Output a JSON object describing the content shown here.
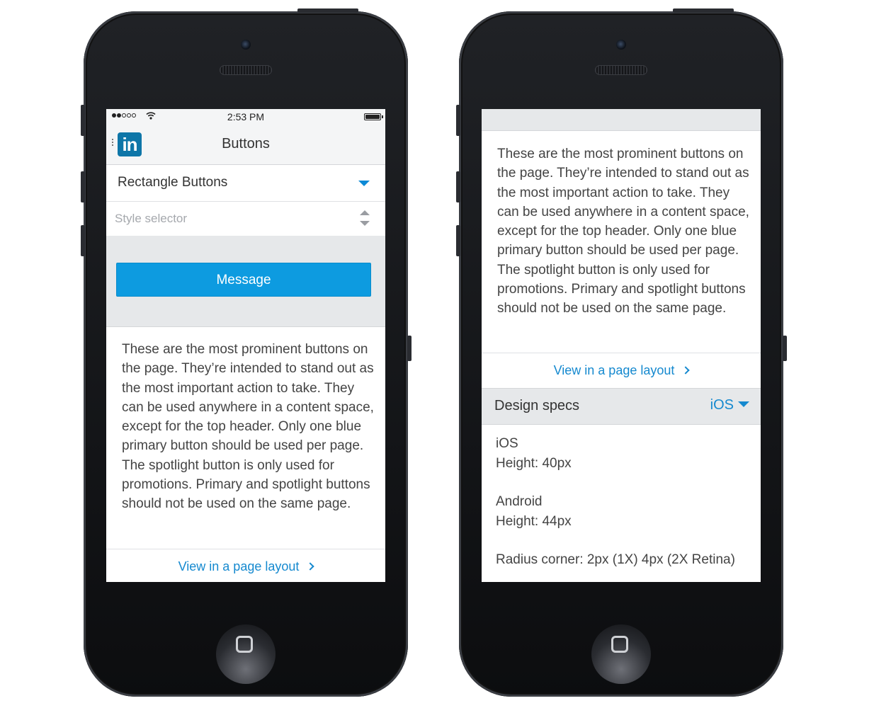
{
  "left_screen": {
    "status_bar": {
      "time": "2:53 PM"
    },
    "nav": {
      "logo": "in",
      "title": "Buttons"
    },
    "type_dropdown": {
      "value": "Rectangle Buttons"
    },
    "style_selector": {
      "placeholder": "Style selector"
    },
    "preview": {
      "button_label": "Message"
    },
    "description": "These are the most prominent buttons on the page. They’re intended to stand out as the most important action to take. They can be used anywhere in a content space, except for the top header. Only one blue primary button should be used per page. The spotlight button is only used for promotions. Primary and spotlight buttons should not be used on the same page.",
    "view_link": "View in a page layout"
  },
  "right_screen": {
    "description": "These are the most prominent buttons on the page. They’re intended to stand out as the most important action to take. They can be used anywhere in a content space, except for the top header. Only one blue primary button should be used per page. The spotlight button is only used for promotions. Primary and spotlight buttons should not be used on the same page.",
    "view_link": "View in a page layout",
    "specs": {
      "title": "Design specs",
      "platform": "iOS",
      "lines": [
        "iOS",
        "Height: 40px",
        "Android",
        "Height: 44px",
        "Radius corner: 2px (1X) 4px (2X Retina)"
      ]
    }
  },
  "colors": {
    "accent": "#0d9be0",
    "link": "#1589cf",
    "brand": "#0e76a8"
  },
  "icons": [
    "linkedin-logo",
    "signal-icon",
    "wifi-icon",
    "battery-icon",
    "chevron-down-icon",
    "stepper-icon",
    "chevron-right-icon"
  ]
}
